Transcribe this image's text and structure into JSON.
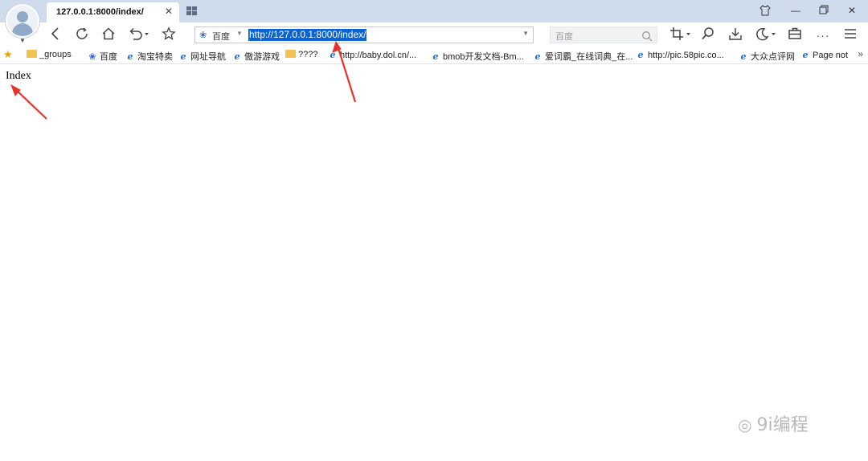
{
  "tab": {
    "title": "127.0.0.1:8000/index/"
  },
  "address_bar": {
    "engine": "百度",
    "url": "http://127.0.0.1:8000/index/"
  },
  "search": {
    "placeholder": "百度"
  },
  "bookmarks": [
    {
      "icon": "folder-icon",
      "label": "_groups"
    },
    {
      "icon": "baidu-paw-icon",
      "label": "百度"
    },
    {
      "icon": "ie-icon",
      "label": "淘宝特卖"
    },
    {
      "icon": "ie-icon",
      "label": "网址导航"
    },
    {
      "icon": "ie-icon",
      "label": "傲游游戏"
    },
    {
      "icon": "folder-icon",
      "label": "????"
    },
    {
      "icon": "ie-icon",
      "label": "http://baby.dol.cn/..."
    },
    {
      "icon": "ie-icon",
      "label": "bmob开发文档-Bm..."
    },
    {
      "icon": "ie-icon",
      "label": "爱词霸_在线词典_在..."
    },
    {
      "icon": "ie-icon",
      "label": "http://pic.58pic.co..."
    },
    {
      "icon": "ie-icon",
      "label": "大众点评网"
    },
    {
      "icon": "ie-icon",
      "label": "Page not"
    }
  ],
  "page": {
    "text": "Index"
  },
  "watermark": {
    "text": "9i编程"
  },
  "colors": {
    "tabstrip": "#cfdcee",
    "selection": "#0a64d6",
    "arrow": "#e8332a"
  }
}
